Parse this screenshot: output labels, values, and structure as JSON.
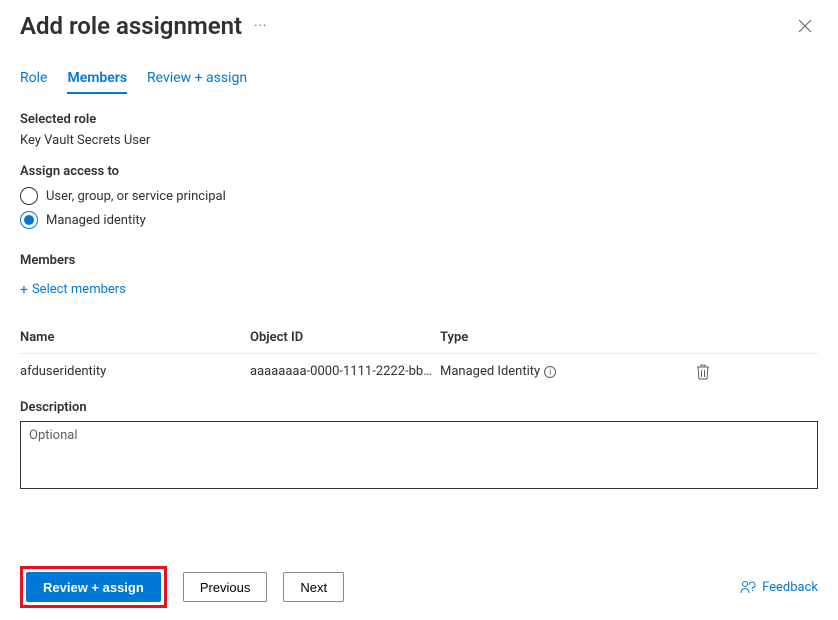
{
  "header": {
    "title": "Add role assignment"
  },
  "tabs": {
    "role": "Role",
    "members": "Members",
    "review": "Review + assign"
  },
  "selectedRole": {
    "label": "Selected role",
    "value": "Key Vault Secrets User"
  },
  "assignAccess": {
    "label": "Assign access to",
    "options": {
      "user": "User, group, or service principal",
      "managed": "Managed identity"
    }
  },
  "members": {
    "label": "Members",
    "selectLink": "Select members",
    "columns": {
      "name": "Name",
      "objectId": "Object ID",
      "type": "Type"
    },
    "rows": [
      {
        "name": "afduseridentity",
        "objectId": "aaaaaaaa-0000-1111-2222-bb…",
        "type": "Managed Identity"
      }
    ]
  },
  "description": {
    "label": "Description",
    "placeholder": "Optional"
  },
  "footer": {
    "review": "Review + assign",
    "previous": "Previous",
    "next": "Next",
    "feedback": "Feedback"
  }
}
